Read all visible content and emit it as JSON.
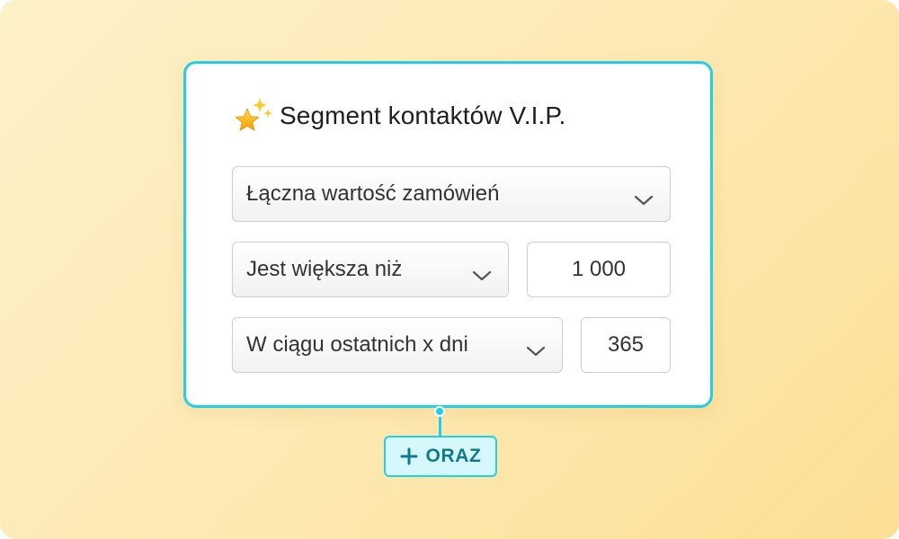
{
  "segment": {
    "title": "Segment kontaktów V.I.P.",
    "icon": "sparkle-star-icon"
  },
  "conditions": {
    "attribute_select": {
      "value": "Łączna wartość zamówień",
      "icon": "chevron-down-icon"
    },
    "operator_select": {
      "value": "Jest większa niż",
      "icon": "chevron-down-icon"
    },
    "threshold_input": {
      "value": "1 000"
    },
    "period_select": {
      "value": "W ciągu ostatnich x dni",
      "icon": "chevron-down-icon"
    },
    "days_input": {
      "value": "365"
    }
  },
  "and_button": {
    "label": "ORAZ",
    "icon": "plus-icon"
  },
  "colors": {
    "accent": "#22cfe6",
    "accent_light": "#d6f7fc",
    "accent_text": "#107a8c",
    "background_from": "#fdf1c8",
    "background_to": "#fddf94"
  }
}
